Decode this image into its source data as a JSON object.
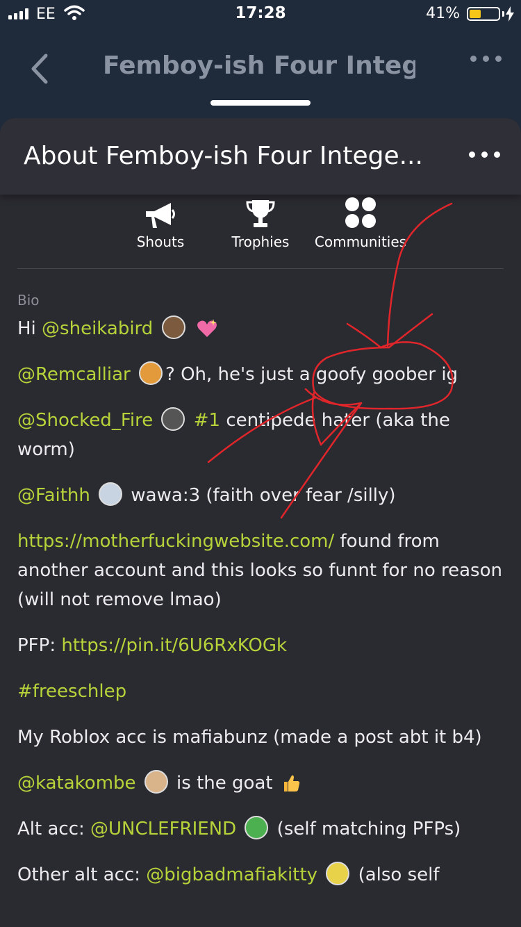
{
  "status_bar": {
    "carrier": "EE",
    "time": "17:28",
    "battery_percent": "41%",
    "battery_level": 0.41
  },
  "header": {
    "title": "Femboy-ish Four Integer"
  },
  "sheet": {
    "title": "About Femboy-ish Four Intege...",
    "tabs": [
      {
        "label": "Shouts",
        "icon": "megaphone-icon"
      },
      {
        "label": "Trophies",
        "icon": "trophy-icon"
      },
      {
        "label": "Communities",
        "icon": "communities-icon"
      }
    ]
  },
  "bio": {
    "label": "Bio",
    "line1": {
      "text": "Hi ",
      "mention": "@sheikabird"
    },
    "line2": {
      "mention": "@Remcalliar",
      "text": "? Oh, he's just a goofy goober ig"
    },
    "line3": {
      "mention": "@Shocked_Fire",
      "tag": "#1",
      "text": " centipede hater (aka the worm)"
    },
    "line4": {
      "mention": "@Faithh",
      "text": " wawa:3 (faith over fear /silly)"
    },
    "line5": {
      "link": "https://motherfuckingwebsite.com/",
      "text": " found from another account and this looks so funnt for no reason (will not remove lmao)"
    },
    "line6": {
      "prefix": "PFP: ",
      "link": "https://pin.it/6U6RxKOGk"
    },
    "line7": {
      "tag": "#freeschlep"
    },
    "line8": {
      "text": "My Roblox acc is mafiabunz (made a post abt it b4)"
    },
    "line9": {
      "mention": "@katakombe",
      "text": " is the goat "
    },
    "line10": {
      "prefix": "Alt acc: ",
      "mention": "@UNCLEFRIEND",
      "text": " (self matching PFPs)"
    },
    "line11": {
      "prefix": "Other alt acc: ",
      "mention": "@bigbadmafiakitty",
      "text": " (also self"
    }
  },
  "colors": {
    "accent": "#b6d43a",
    "background": "#2a2a31",
    "header_bg": "#1f2a3a",
    "annotation": "#e0262a"
  }
}
